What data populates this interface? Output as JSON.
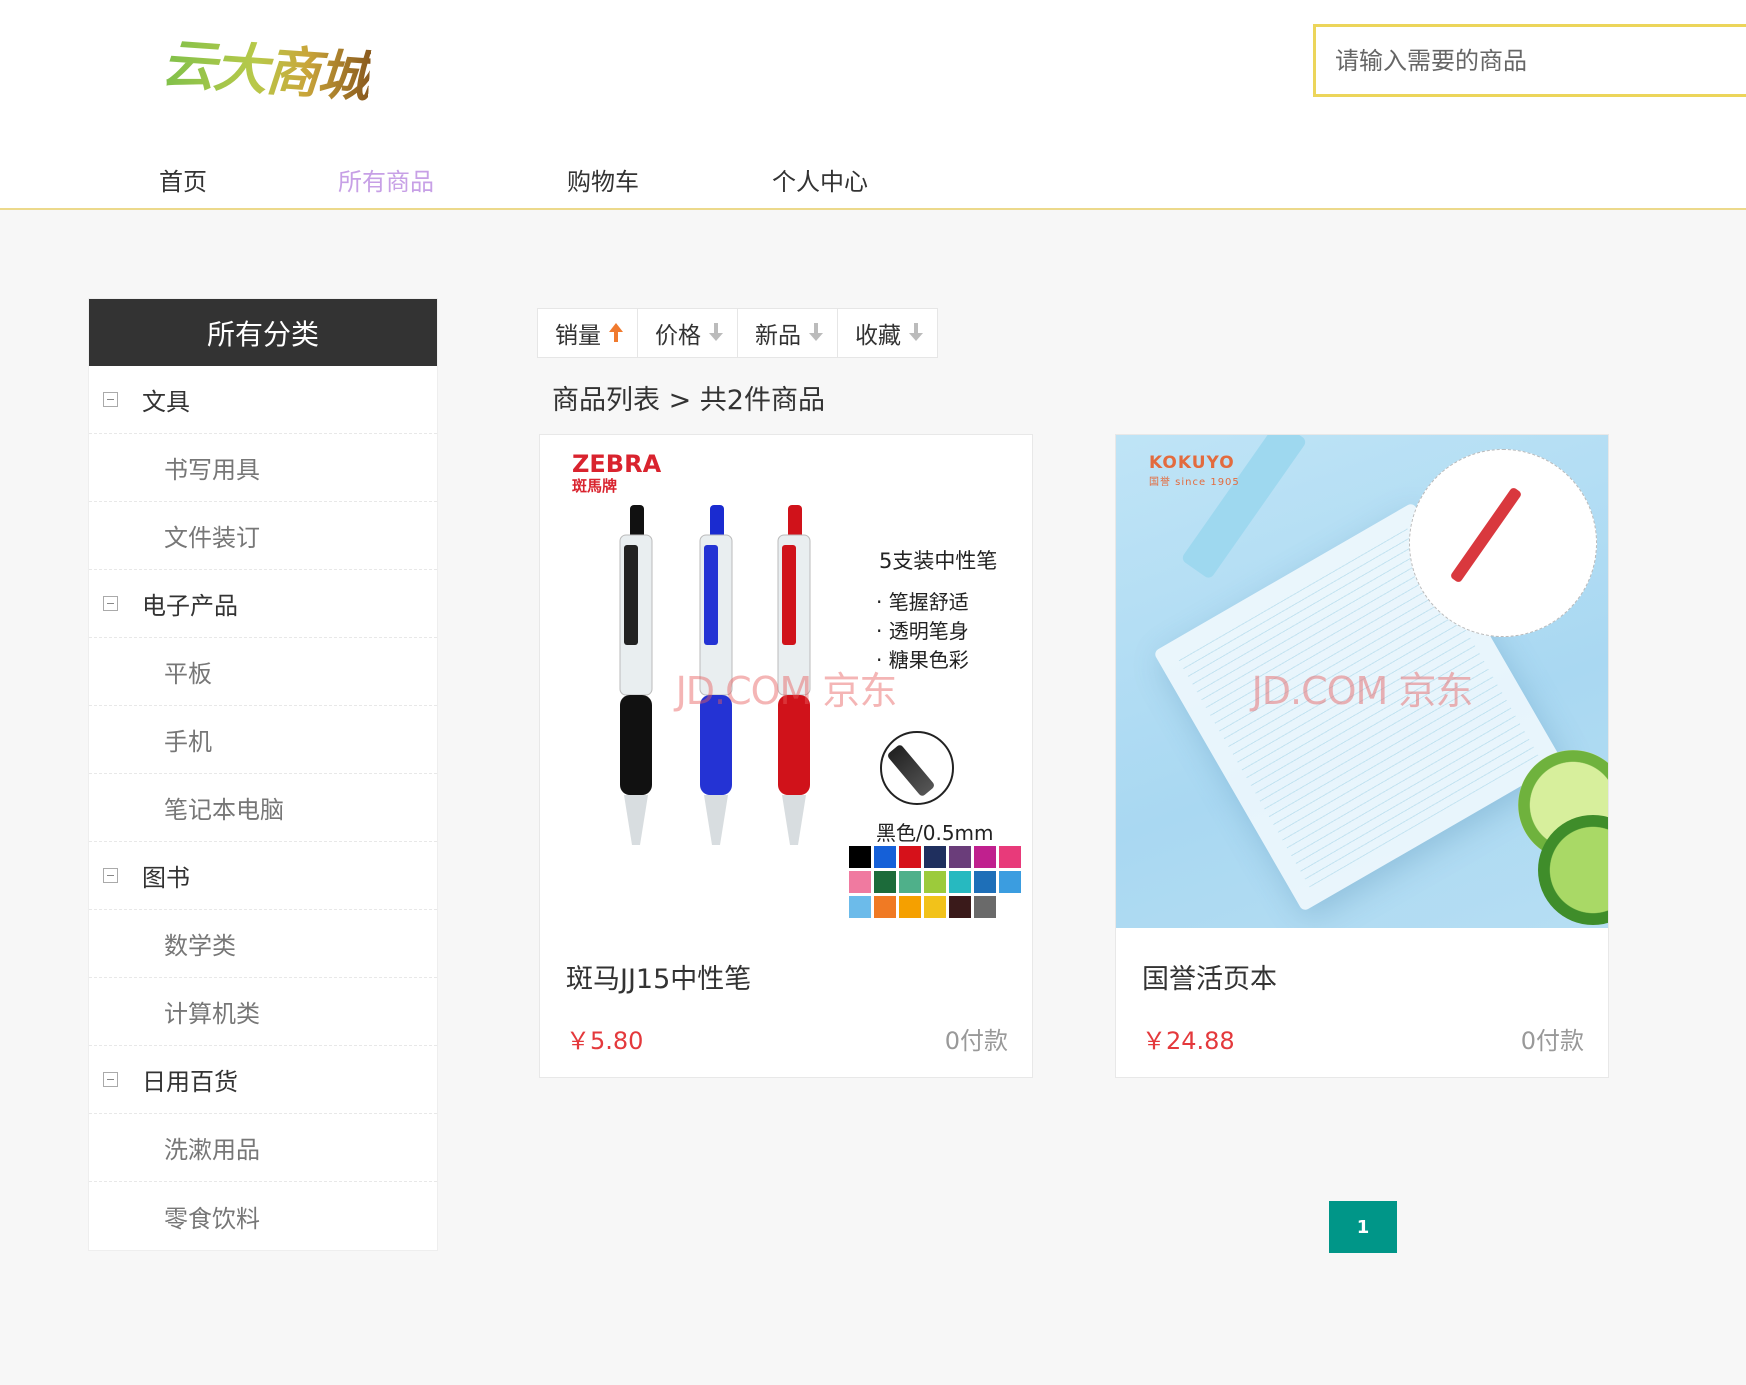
{
  "header": {
    "logo_text": "云大商城",
    "search_placeholder": "请输入需要的商品"
  },
  "nav": [
    {
      "label": "首页",
      "active": false
    },
    {
      "label": "所有商品",
      "active": true
    },
    {
      "label": "购物车",
      "active": false
    },
    {
      "label": "个人中心",
      "active": false
    }
  ],
  "sidebar": {
    "title": "所有分类",
    "categories": [
      {
        "label": "文具",
        "level": "parent"
      },
      {
        "label": "书写用具",
        "level": "child"
      },
      {
        "label": "文件装订",
        "level": "child"
      },
      {
        "label": "电子产品",
        "level": "parent"
      },
      {
        "label": "平板",
        "level": "child"
      },
      {
        "label": "手机",
        "level": "child"
      },
      {
        "label": "笔记本电脑",
        "level": "child"
      },
      {
        "label": "图书",
        "level": "parent"
      },
      {
        "label": "数学类",
        "level": "child"
      },
      {
        "label": "计算机类",
        "level": "child"
      },
      {
        "label": "日用百货",
        "level": "parent"
      },
      {
        "label": "洗漱用品",
        "level": "child"
      },
      {
        "label": "零食饮料",
        "level": "child"
      }
    ]
  },
  "sort": [
    {
      "label": "销量",
      "direction": "up",
      "active": true
    },
    {
      "label": "价格",
      "direction": "down",
      "active": false
    },
    {
      "label": "新品",
      "direction": "down",
      "active": false
    },
    {
      "label": "收藏",
      "direction": "down",
      "active": false
    }
  ],
  "list_title": "商品列表 > 共2件商品",
  "products": [
    {
      "name": "斑马JJ15中性笔",
      "price": "￥5.80",
      "paid": "0付款",
      "image": {
        "brand": "ZEBRA",
        "brand_sub": "斑馬牌",
        "headline": "5支装中性笔",
        "bullets": [
          "· 笔握舒适",
          "· 透明笔身",
          "· 糖果色彩"
        ],
        "spec": "黑色/0.5mm",
        "watermark": "JD.COM 京东",
        "swatch_colors": [
          "#000000",
          "#1560d8",
          "#d6111a",
          "#1f2f5e",
          "#6a3d7a",
          "#c0208e",
          "#e83a7a",
          "#f07aa0",
          "#1c6b3a",
          "#4fb08a",
          "#9ccb3b",
          "#27b9c0",
          "#1e6fb8",
          "#3b9de0",
          "#6cbbea",
          "#f07a24",
          "#f5a000",
          "#f2c21a",
          "#3a1a1a",
          "#6a6a6a"
        ]
      }
    },
    {
      "name": "国誉活页本",
      "price": "￥24.88",
      "paid": "0付款",
      "image": {
        "brand": "KOKUYO",
        "brand_sub": "国誉 since 1905",
        "watermark": "JD.COM 京东"
      }
    }
  ],
  "pagination": {
    "current": "1"
  },
  "colors": {
    "accent": "#009688",
    "price": "#e4393c",
    "nav_active": "#c7a0e6",
    "header_border": "#ecd98b",
    "search_border": "#ecd55a"
  }
}
